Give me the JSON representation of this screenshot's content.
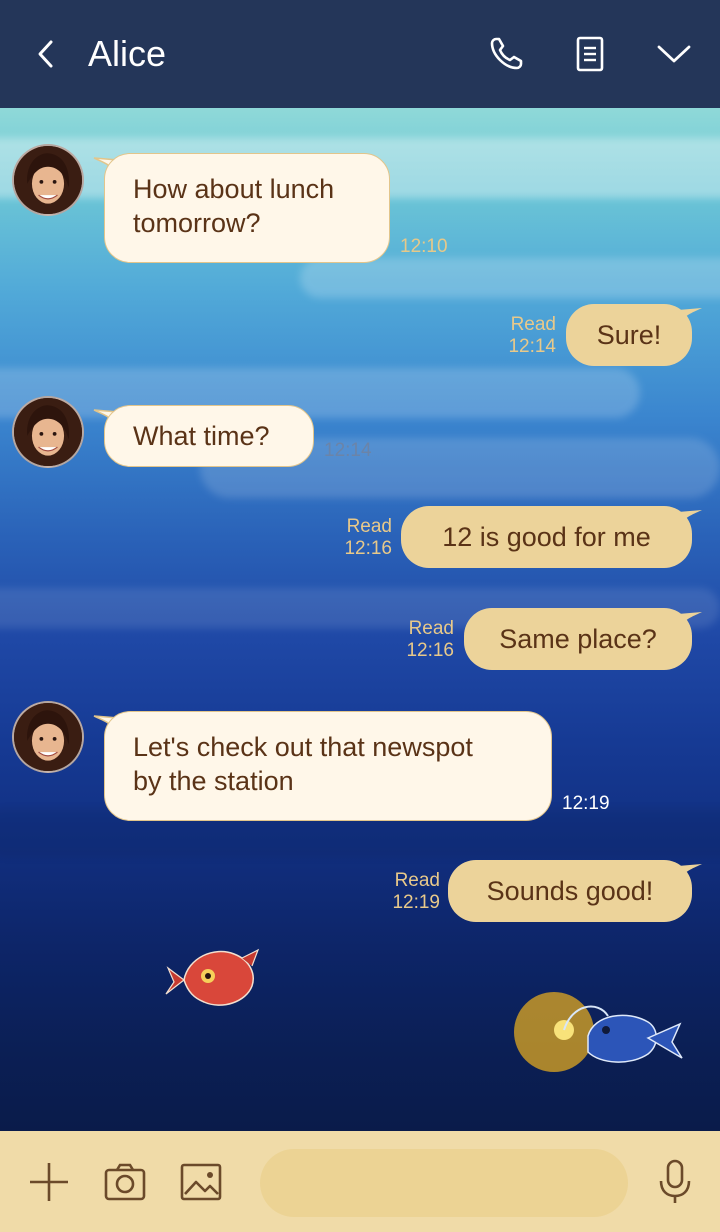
{
  "header": {
    "title": "Alice"
  },
  "icons": {
    "back": "chevron-left-icon",
    "call": "phone-icon",
    "notes": "note-icon",
    "menu": "chevron-down-icon",
    "add": "plus-icon",
    "camera": "camera-icon",
    "photo": "image-icon",
    "emoji": "smiley-icon",
    "mic": "microphone-icon"
  },
  "colors": {
    "header_bg": "#243659",
    "bubble_in_bg": "#fff7e9",
    "bubble_out_bg": "#ecd39a",
    "text_brown": "#5a3317",
    "bottom_bg": "#f0dba8"
  },
  "messages": [
    {
      "id": 1,
      "from": "Alice",
      "dir": "in",
      "lines": [
        "How about lunch",
        "tomorrow?"
      ],
      "time": "12:10"
    },
    {
      "id": 2,
      "from": "me",
      "dir": "out",
      "text": "Sure!",
      "status": "Read",
      "time": "12:14"
    },
    {
      "id": 3,
      "from": "Alice",
      "dir": "in",
      "lines": [
        "What time?"
      ],
      "time": "12:14"
    },
    {
      "id": 4,
      "from": "me",
      "dir": "out",
      "text": "12 is good for me",
      "status": "Read",
      "time": "12:16"
    },
    {
      "id": 5,
      "from": "me",
      "dir": "out",
      "text": "Same place?",
      "status": "Read",
      "time": "12:16"
    },
    {
      "id": 6,
      "from": "Alice",
      "dir": "in",
      "lines": [
        "Let's check out that newspot",
        "by the station"
      ],
      "time": "12:19"
    },
    {
      "id": 7,
      "from": "me",
      "dir": "out",
      "text": "Sounds good!",
      "status": "Read",
      "time": "12:19"
    }
  ]
}
